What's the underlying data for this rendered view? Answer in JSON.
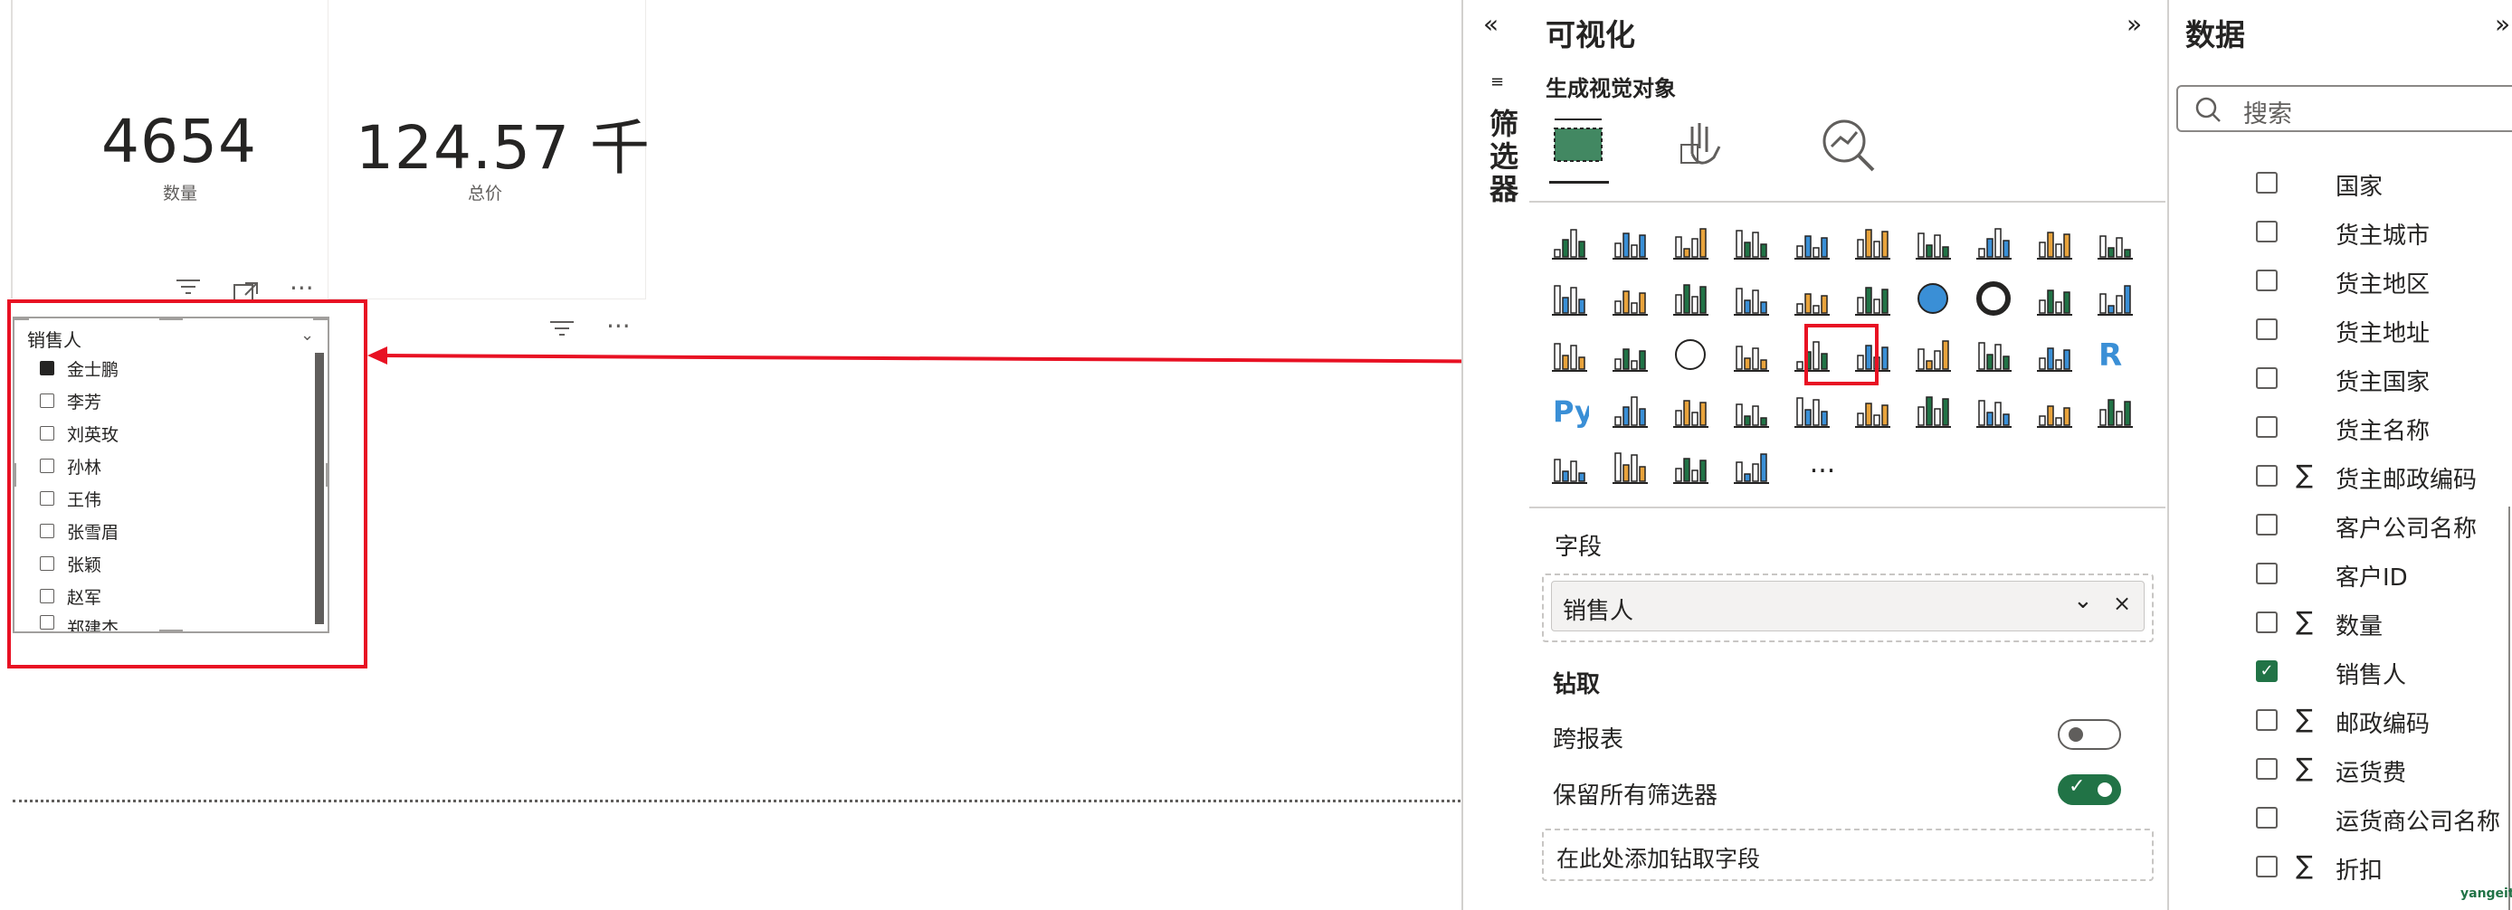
{
  "cards": [
    {
      "value": "4654",
      "label": "数量"
    },
    {
      "value": "124.57 千",
      "label": "总价"
    }
  ],
  "slicer": {
    "title": "销售人",
    "items": [
      {
        "label": "金士鹏",
        "checked": true
      },
      {
        "label": "李芳",
        "checked": false
      },
      {
        "label": "刘英玫",
        "checked": false
      },
      {
        "label": "孙林",
        "checked": false
      },
      {
        "label": "王伟",
        "checked": false
      },
      {
        "label": "张雪眉",
        "checked": false
      },
      {
        "label": "张颖",
        "checked": false
      },
      {
        "label": "赵军",
        "checked": false
      },
      {
        "label": "郑建杰",
        "checked": false
      }
    ]
  },
  "filters_pane": {
    "label": "筛选器"
  },
  "viz_pane": {
    "title": "可视化",
    "build_label": "生成视觉对象",
    "more_label": "...",
    "fields_label": "字段",
    "field_value": "销售人",
    "drill_label": "钻取",
    "cross_report_label": "跨报表",
    "keep_filters_label": "保留所有筛选器",
    "add_drill_placeholder": "在此处添加钻取字段",
    "cross_report_on": false,
    "keep_filters_on": true,
    "accent": "#217346",
    "highlight": "#e81123"
  },
  "data_pane": {
    "title": "数据",
    "search_placeholder": "搜索",
    "fields": [
      {
        "name": "国家",
        "sigma": false,
        "checked": false
      },
      {
        "name": "货主城市",
        "sigma": false,
        "checked": false
      },
      {
        "name": "货主地区",
        "sigma": false,
        "checked": false
      },
      {
        "name": "货主地址",
        "sigma": false,
        "checked": false
      },
      {
        "name": "货主国家",
        "sigma": false,
        "checked": false
      },
      {
        "name": "货主名称",
        "sigma": false,
        "checked": false
      },
      {
        "name": "货主邮政编码",
        "sigma": true,
        "checked": false
      },
      {
        "name": "客户公司名称",
        "sigma": false,
        "checked": false
      },
      {
        "name": "客户ID",
        "sigma": false,
        "checked": false
      },
      {
        "name": "数量",
        "sigma": true,
        "checked": false
      },
      {
        "name": "销售人",
        "sigma": false,
        "checked": true
      },
      {
        "name": "邮政编码",
        "sigma": true,
        "checked": false
      },
      {
        "name": "运货费",
        "sigma": true,
        "checked": false
      },
      {
        "name": "运货商公司名称",
        "sigma": false,
        "checked": false
      },
      {
        "name": "折扣",
        "sigma": true,
        "checked": false
      }
    ]
  },
  "watermark": "yangeit"
}
